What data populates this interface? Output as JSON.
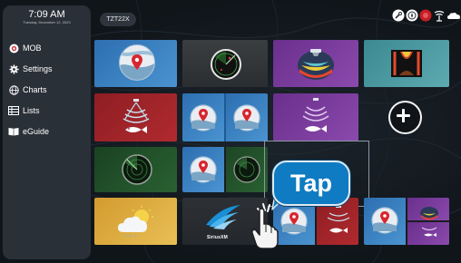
{
  "clock": {
    "time": "7:09 AM",
    "date": "Tuesday, December 12, 2023"
  },
  "sidebar": {
    "items": [
      {
        "label": "MOB",
        "icon": "mob-icon"
      },
      {
        "label": "Settings",
        "icon": "gear-icon"
      },
      {
        "label": "Charts",
        "icon": "globe-icon"
      },
      {
        "label": "Lists",
        "icon": "list-icon"
      },
      {
        "label": "eGuide",
        "icon": "book-icon"
      }
    ]
  },
  "topbar": {
    "device": "TZT22X",
    "status_icons": [
      "wrench-icon",
      "compass-icon",
      "alarm-icon",
      "antenna-icon",
      "weather-icon"
    ]
  },
  "tiles": [
    {
      "name": "chart-app-tile",
      "icon": "chart-pin-icon"
    },
    {
      "name": "radar-app-tile",
      "icon": "radar-icon"
    },
    {
      "name": "3d-sonar-app-tile",
      "icon": "3d-sonar-icon"
    },
    {
      "name": "sonar-app-tile",
      "icon": "sonar-icon"
    },
    {
      "name": "fish-finder-app-tile",
      "icon": "fish-finder-icon"
    },
    {
      "name": "dual-chart-app-tile",
      "icon": "dual-chart-icon"
    },
    {
      "name": "omni-sonar-app-tile",
      "icon": "omni-sonar-icon"
    },
    {
      "name": "night-radar-app-tile",
      "icon": "night-radar-icon"
    },
    {
      "name": "chart-radar-app-tile",
      "icon": "chart-radar-icon"
    },
    {
      "name": "weather-app-tile",
      "icon": "weather-icon"
    },
    {
      "name": "siriusxm-app-tile",
      "icon": "siriusxm-icon"
    },
    {
      "name": "chart-fishfinder-app-tile",
      "icon": "chart-fishfinder-icon"
    },
    {
      "name": "chart-multisonar-app-tile",
      "icon": "chart-multisonar-icon"
    }
  ],
  "add_button": {
    "icon": "plus-icon"
  },
  "siriusxm_label": "SiriusXM",
  "callout": {
    "text": "Tap"
  },
  "colors": {
    "sidebar": "#2a3038",
    "accent": "#0f7bc2",
    "chart_tile": "#2b6fb0",
    "radar_tile": "#2f3335",
    "purple_tile": "#6d3a8b",
    "teal_tile": "#3d8a92",
    "red_tile": "#9c2126",
    "green_tile": "#1e4a25",
    "weather_tile": "#d6a53a"
  }
}
